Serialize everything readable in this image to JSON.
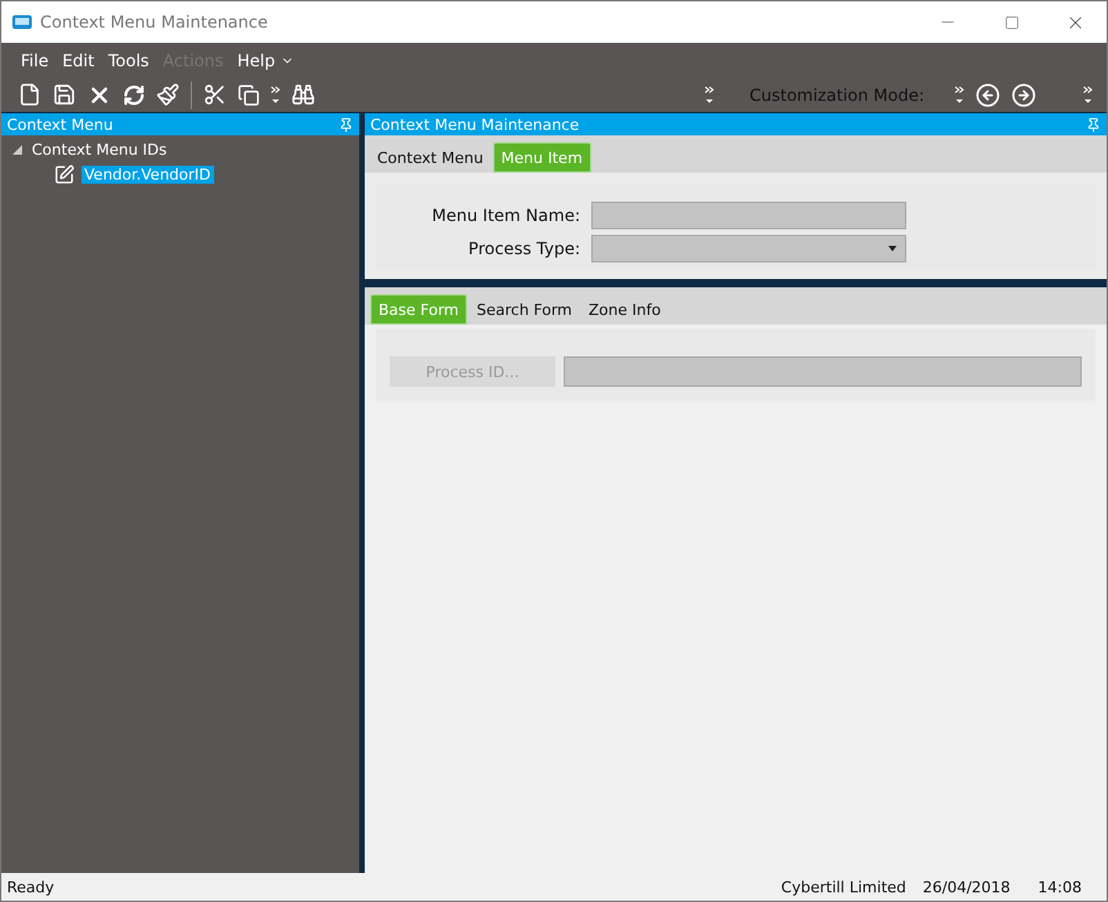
{
  "window": {
    "title": "Context Menu Maintenance"
  },
  "menu": [
    {
      "label": "File",
      "disabled": false
    },
    {
      "label": "Edit",
      "disabled": false
    },
    {
      "label": "Tools",
      "disabled": false
    },
    {
      "label": "Actions",
      "disabled": true
    },
    {
      "label": "Help",
      "disabled": false
    }
  ],
  "toolbar": {
    "customization_label": "Customization Mode:"
  },
  "left_panel": {
    "title": "Context Menu",
    "tree": [
      {
        "label": "Context Menu IDs",
        "expanded": true,
        "selected": false,
        "children": [
          {
            "label": "Vendor.VendorID",
            "selected": true
          }
        ]
      }
    ]
  },
  "right_panel": {
    "title": "Context Menu Maintenance",
    "tabs": [
      {
        "label": "Context Menu",
        "selected": false
      },
      {
        "label": "Menu Item",
        "selected": true
      }
    ],
    "fields": [
      {
        "kind": "text",
        "label": "Menu Item Name:"
      },
      {
        "kind": "dropdown",
        "label": "Process Type:"
      }
    ],
    "sub_tabs": [
      {
        "label": "Base Form",
        "selected": true
      },
      {
        "label": "Search Form",
        "selected": false
      },
      {
        "label": "Zone Info",
        "selected": false
      }
    ],
    "process_button": {
      "label": "Process ID...",
      "disabled": true
    }
  },
  "status_bar": {
    "status": "Ready",
    "company": "Cybertill Limited",
    "date": "26/04/2018",
    "time": "14:08"
  }
}
